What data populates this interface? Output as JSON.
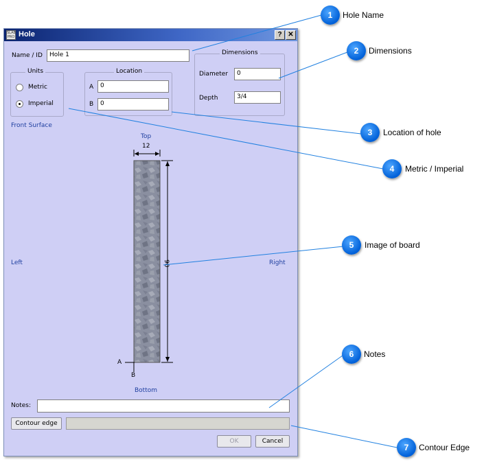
{
  "window": {
    "title": "Hole",
    "app_icon_text": "SLAB PRO",
    "help_btn": "?",
    "close_btn": "✕"
  },
  "form": {
    "name_label": "Name / ID",
    "name_value": "Hole 1",
    "units": {
      "legend": "Units",
      "metric": "Metric",
      "imperial": "Imperial",
      "selected": "Imperial"
    },
    "location": {
      "legend": "Location",
      "a_label": "A",
      "a_value": "0",
      "b_label": "B",
      "b_value": "0"
    },
    "dimensions": {
      "legend": "Dimensions",
      "diameter_label": "Diameter",
      "diameter_value": "0",
      "depth_label": "Depth",
      "depth_value": "3/4"
    },
    "surface_label": "Front Surface",
    "board": {
      "top": "Top",
      "bottom": "Bottom",
      "left": "Left",
      "right": "Right",
      "width": "12",
      "height": "90",
      "corner_a": "A",
      "corner_b": "B"
    },
    "notes_label": "Notes:",
    "notes_value": "",
    "contour_button": "Contour edge",
    "contour_value": "",
    "ok": "OK",
    "cancel": "Cancel"
  },
  "callouts": [
    {
      "n": "1",
      "text": "Hole Name"
    },
    {
      "n": "2",
      "text": "Dimensions"
    },
    {
      "n": "3",
      "text": "Location of hole"
    },
    {
      "n": "4",
      "text": "Metric / Imperial"
    },
    {
      "n": "5",
      "text": "Image of board"
    },
    {
      "n": "6",
      "text": "Notes"
    },
    {
      "n": "7",
      "text": "Contour Edge"
    }
  ],
  "colors": {
    "dialog_bg": "#cfcff5",
    "title_bar": "#0b2470",
    "callout": "#0a78f0",
    "leader_line": "#2080e0",
    "label_blue": "#2040a0"
  }
}
